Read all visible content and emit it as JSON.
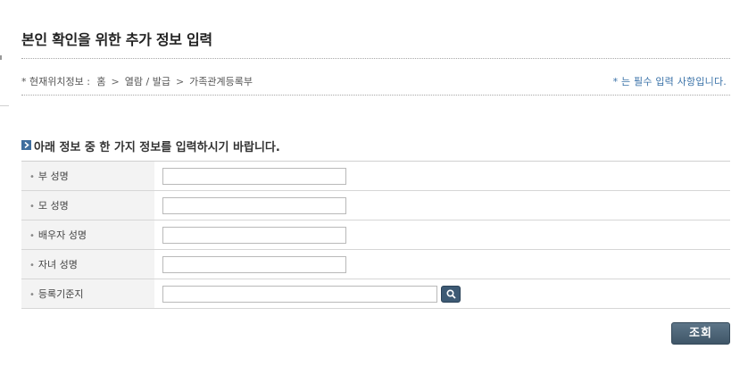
{
  "page": {
    "title": "본인 확인을 위한 추가 정보 입력"
  },
  "breadcrumb": {
    "prefix": "* 현재위치정보 :",
    "items": [
      "홈",
      "열람 / 발급",
      "가족관계등록부"
    ],
    "separator": ">"
  },
  "required_note": "* 는 필수 입력 사항입니다.",
  "form": {
    "heading": "아래 정보 중 한 가지 정보를 입력하시기 바랍니다.",
    "fields": [
      {
        "label": "부 성명",
        "value": ""
      },
      {
        "label": "모 성명",
        "value": ""
      },
      {
        "label": "배우자 성명",
        "value": ""
      },
      {
        "label": "자녀 성명",
        "value": ""
      },
      {
        "label": "등록기준지",
        "value": ""
      }
    ],
    "label_bullet": "•"
  },
  "buttons": {
    "submit_label": "조회",
    "search_icon": "search-icon"
  },
  "colors": {
    "accent_blue": "#3a72a8",
    "button_dark": "#3f5668",
    "label_bg": "#f3f3f3"
  }
}
